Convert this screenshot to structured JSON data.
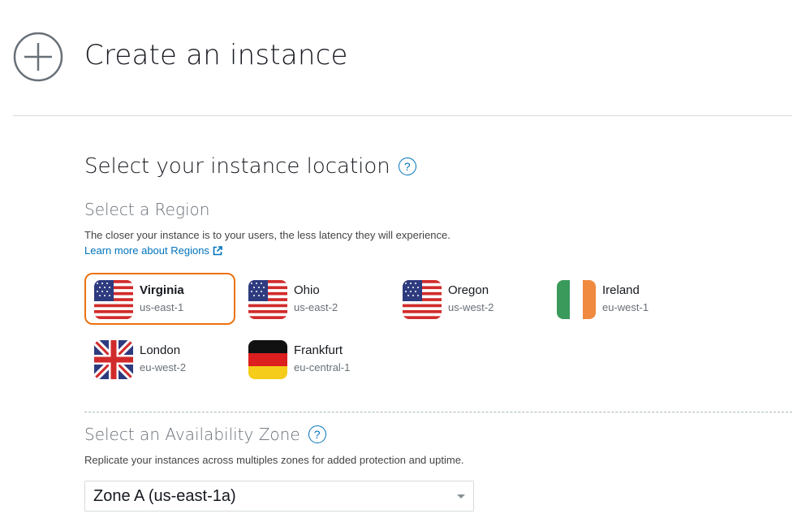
{
  "header": {
    "title": "Create an instance",
    "icon": "plus-circle-icon"
  },
  "location": {
    "title": "Select your instance location",
    "help": "?"
  },
  "region": {
    "title": "Select a Region",
    "description": "The closer your instance is to your users, the less latency they will experience.",
    "learn_more": "Learn more about Regions",
    "selected": "Virginia",
    "items": [
      {
        "name": "Virginia",
        "code": "us-east-1",
        "flag": "us-flag-icon"
      },
      {
        "name": "Ohio",
        "code": "us-east-2",
        "flag": "us-flag-icon"
      },
      {
        "name": "Oregon",
        "code": "us-west-2",
        "flag": "us-flag-icon"
      },
      {
        "name": "Ireland",
        "code": "eu-west-1",
        "flag": "ireland-flag-icon"
      },
      {
        "name": "London",
        "code": "eu-west-2",
        "flag": "uk-flag-icon"
      },
      {
        "name": "Frankfurt",
        "code": "eu-central-1",
        "flag": "germany-flag-icon"
      }
    ]
  },
  "zone": {
    "title": "Select an Availability Zone",
    "help": "?",
    "description": "Replicate your instances across multiples zones for added protection and uptime.",
    "value": "Zone A (us-east-1a)"
  },
  "colors": {
    "accent": "#ec7211",
    "link": "#0073bb"
  }
}
